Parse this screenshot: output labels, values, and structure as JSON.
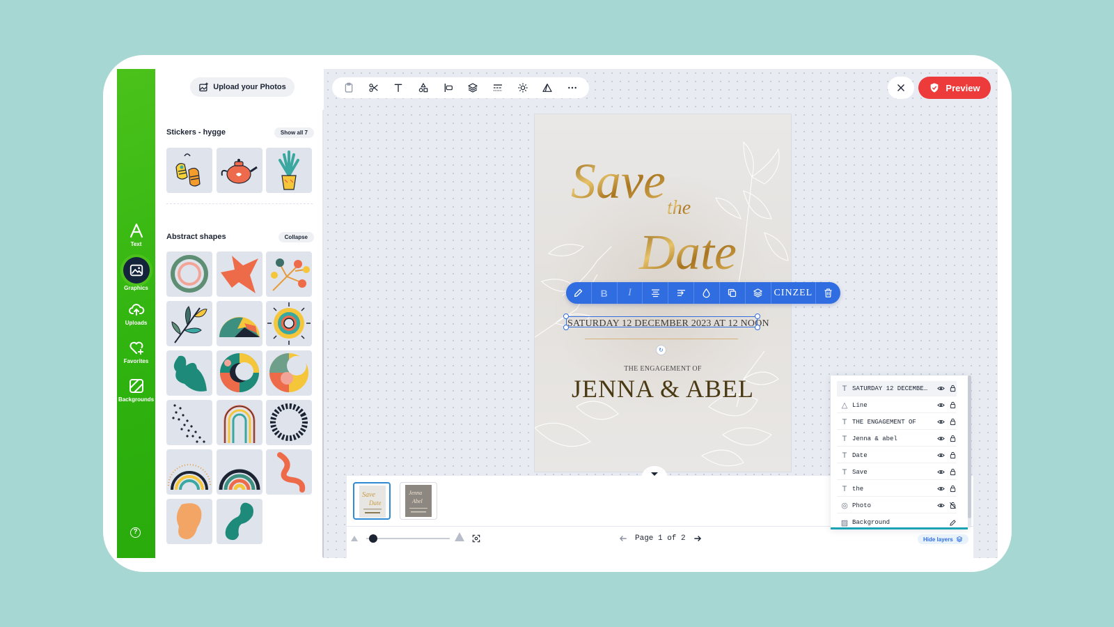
{
  "sidebar": {
    "items": [
      {
        "label": "Text",
        "icon": "text-icon"
      },
      {
        "label": "Graphics",
        "icon": "graphics-icon",
        "active": true
      },
      {
        "label": "Uploads",
        "icon": "upload-cloud-icon"
      },
      {
        "label": "Favorites",
        "icon": "heart-plus-icon"
      },
      {
        "label": "Backgrounds",
        "icon": "backgrounds-icon"
      }
    ],
    "help": "?"
  },
  "panel": {
    "upload_label": "Upload your Photos",
    "stickers_title": "Stickers - hygge",
    "stickers_action": "Show all 7",
    "shapes_title": "Abstract shapes",
    "shapes_action": "Collapse"
  },
  "header": {
    "preview_label": "Preview"
  },
  "card": {
    "title_save": "Save",
    "title_the": "the",
    "title_date": "Date",
    "date_text": "SATURDAY 12 DECEMBER 2023 AT 12 NOON",
    "engagement_of": "THE ENGAGEMENT OF",
    "names": "JENNA & ABEL"
  },
  "text_toolbar": {
    "font_name": "CINZEL",
    "bold": "B",
    "italic": "I"
  },
  "pager": {
    "text": "Page 1 of 2"
  },
  "layers": {
    "rows": [
      {
        "type": "text",
        "name": "SATURDAY 12 DECEMBE…",
        "locked_icon": "lock-icon"
      },
      {
        "type": "shape",
        "name": "Line",
        "locked_icon": "lock-icon"
      },
      {
        "type": "text",
        "name": "THE ENGAGEMENT OF",
        "locked_icon": "lock-icon"
      },
      {
        "type": "text",
        "name": "Jenna & abel",
        "locked_icon": "lock-icon"
      },
      {
        "type": "text",
        "name": "Date",
        "locked_icon": "lock-icon"
      },
      {
        "type": "text",
        "name": "Save",
        "locked_icon": "lock-icon"
      },
      {
        "type": "text",
        "name": "the",
        "locked_icon": "lock-icon"
      },
      {
        "type": "photo",
        "name": "Photo",
        "locked_icon": "unlock-icon"
      },
      {
        "type": "background",
        "name": "Background",
        "locked_icon": "edit-icon"
      }
    ],
    "hide_label": "Hide layers"
  },
  "colors": {
    "rail_green": "#2fb30f",
    "accent_blue": "#2f6de0",
    "preview_red": "#ed3b3b",
    "gold": "#b8862a"
  }
}
